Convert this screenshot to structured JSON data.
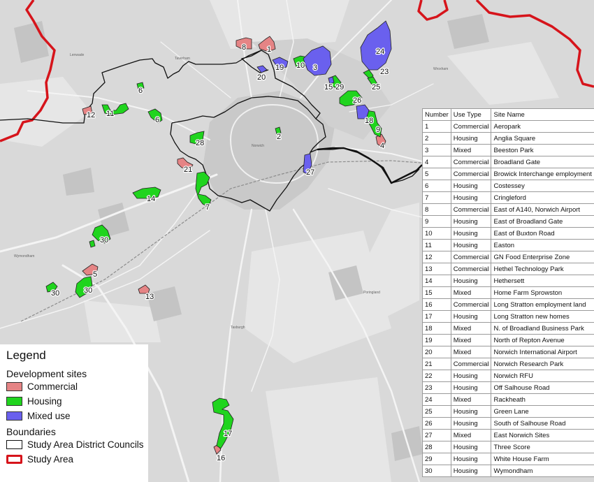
{
  "legend": {
    "title": "Legend",
    "development_heading": "Development sites",
    "commercial_label": "Commercial",
    "housing_label": "Housing",
    "mixed_label": "Mixed use",
    "boundaries_heading": "Boundaries",
    "councils_label": "Study Area District Councils",
    "study_area_label": "Study Area"
  },
  "colors": {
    "commercial": "#e58485",
    "housing": "#20d41e",
    "mixed": "#6a60ee",
    "study_area_boundary": "#d6141b",
    "council_boundary": "#111111"
  },
  "table": {
    "headers": [
      "Number",
      "Use Type",
      "Site Name"
    ],
    "rows": [
      [
        "1",
        "Commercial",
        "Aeropark"
      ],
      [
        "2",
        "Housing",
        "Anglia Square"
      ],
      [
        "3",
        "Mixed",
        "Beeston Park"
      ],
      [
        "4",
        "Commercial",
        "Broadland Gate"
      ],
      [
        "5",
        "Commercial",
        "Browick Interchange employment"
      ],
      [
        "6",
        "Housing",
        "Costessey"
      ],
      [
        "7",
        "Housing",
        "Cringleford"
      ],
      [
        "8",
        "Commercial",
        "East of A140, Norwich Airport"
      ],
      [
        "9",
        "Housing",
        "East of Broadland Gate"
      ],
      [
        "10",
        "Housing",
        "East of Buxton Road"
      ],
      [
        "11",
        "Housing",
        "Easton"
      ],
      [
        "12",
        "Commercial",
        "GN Food Enterprise Zone"
      ],
      [
        "13",
        "Commercial",
        "Hethel Technology Park"
      ],
      [
        "14",
        "Housing",
        "Hethersett"
      ],
      [
        "15",
        "Mixed",
        "Home Farm Sprowston"
      ],
      [
        "16",
        "Commercial",
        "Long Stratton employment land"
      ],
      [
        "17",
        "Housing",
        "Long Stratton new homes"
      ],
      [
        "18",
        "Mixed",
        "N. of Broadland Business Park"
      ],
      [
        "19",
        "Mixed",
        "North of Repton Avenue"
      ],
      [
        "20",
        "Mixed",
        "Norwich International Airport"
      ],
      [
        "21",
        "Commercial",
        "Norwich Research Park"
      ],
      [
        "22",
        "Housing",
        "Norwich RFU"
      ],
      [
        "23",
        "Housing",
        "Off Salhouse Road"
      ],
      [
        "24",
        "Mixed",
        "Rackheath"
      ],
      [
        "25",
        "Housing",
        "Green Lane"
      ],
      [
        "26",
        "Housing",
        "South of Salhouse Road"
      ],
      [
        "27",
        "Mixed",
        "East Norwich Sites"
      ],
      [
        "28",
        "Housing",
        "Three Score"
      ],
      [
        "29",
        "Housing",
        "White House Farm"
      ],
      [
        "30",
        "Housing",
        "Wymondham"
      ]
    ]
  },
  "map_labels": [
    {
      "id": "label-1",
      "text": "1",
      "type": "commercial"
    },
    {
      "id": "label-2",
      "text": "2",
      "type": "housing"
    },
    {
      "id": "label-3",
      "text": "3",
      "type": "mixed"
    },
    {
      "id": "label-4",
      "text": "4",
      "type": "commercial"
    },
    {
      "id": "label-5",
      "text": "5",
      "type": "commercial"
    },
    {
      "id": "label-6a",
      "text": "6",
      "type": "housing"
    },
    {
      "id": "label-6b",
      "text": "6",
      "type": "housing"
    },
    {
      "id": "label-7",
      "text": "7",
      "type": "housing"
    },
    {
      "id": "label-8",
      "text": "8",
      "type": "commercial"
    },
    {
      "id": "label-9",
      "text": "9",
      "type": "housing"
    },
    {
      "id": "label-10",
      "text": "10",
      "type": "housing"
    },
    {
      "id": "label-11",
      "text": "11",
      "type": "housing"
    },
    {
      "id": "label-12",
      "text": "12",
      "type": "commercial"
    },
    {
      "id": "label-13",
      "text": "13",
      "type": "commercial"
    },
    {
      "id": "label-14",
      "text": "14",
      "type": "housing"
    },
    {
      "id": "label-15",
      "text": "15",
      "type": "mixed"
    },
    {
      "id": "label-16",
      "text": "16",
      "type": "commercial"
    },
    {
      "id": "label-17",
      "text": "17",
      "type": "housing"
    },
    {
      "id": "label-18",
      "text": "18",
      "type": "mixed"
    },
    {
      "id": "label-19",
      "text": "19",
      "type": "mixed"
    },
    {
      "id": "label-20",
      "text": "20",
      "type": "mixed"
    },
    {
      "id": "label-21",
      "text": "21",
      "type": "commercial"
    },
    {
      "id": "label-23",
      "text": "23",
      "type": "housing"
    },
    {
      "id": "label-24",
      "text": "24",
      "type": "mixed"
    },
    {
      "id": "label-25",
      "text": "25",
      "type": "housing"
    },
    {
      "id": "label-26",
      "text": "26",
      "type": "housing"
    },
    {
      "id": "label-27",
      "text": "27",
      "type": "mixed"
    },
    {
      "id": "label-28",
      "text": "28",
      "type": "housing"
    },
    {
      "id": "label-29",
      "text": "29",
      "type": "housing"
    },
    {
      "id": "label-30a",
      "text": "30",
      "type": "housing"
    },
    {
      "id": "label-30b",
      "text": "30",
      "type": "housing"
    },
    {
      "id": "label-30c",
      "text": "30",
      "type": "housing"
    }
  ]
}
